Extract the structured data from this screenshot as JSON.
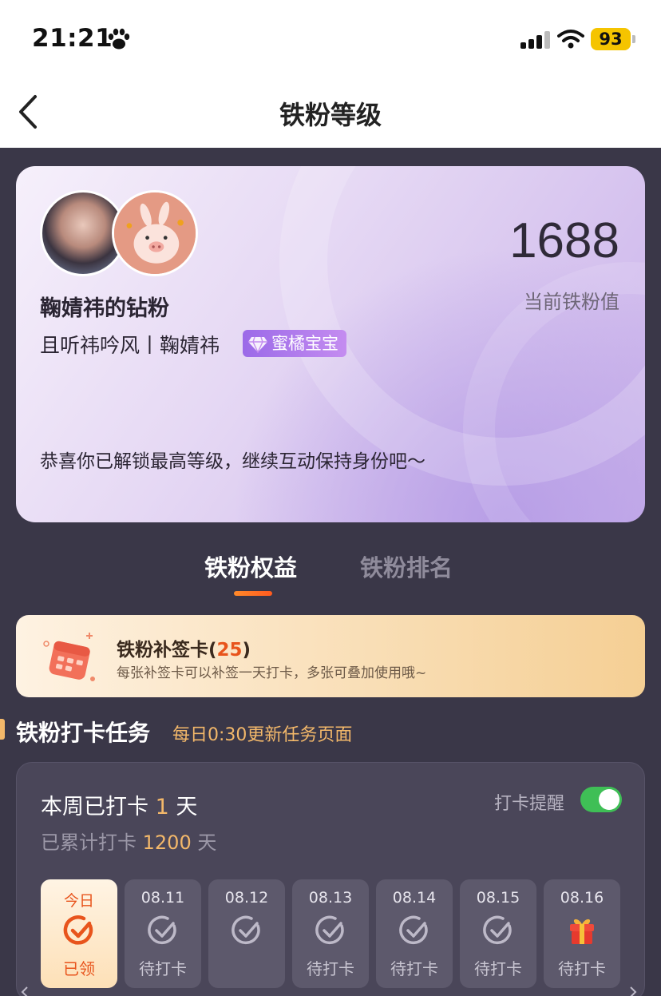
{
  "status_bar": {
    "time": "21:21",
    "battery": "93"
  },
  "nav": {
    "title": "铁粉等级"
  },
  "profile": {
    "score": "1688",
    "score_label": "当前铁粉值",
    "fan_name": "鞠婧祎的钻粉",
    "subtitle": "且听祎吟风丨鞠婧祎",
    "badge": "蜜橘宝宝",
    "message": "恭喜你已解锁最高等级，继续互动保持身份吧～"
  },
  "tabs": [
    {
      "label": "铁粉权益",
      "active": true
    },
    {
      "label": "铁粉排名",
      "active": false
    }
  ],
  "makeup_card": {
    "title": "铁粉补签卡(",
    "count": "25",
    "title_end": ")",
    "subtitle": "每张补签卡可以补签一天打卡，多张可叠加使用哦~"
  },
  "section": {
    "title": "铁粉打卡任务",
    "note": "每日0:30更新任务页面"
  },
  "checkin": {
    "week_prefix": "本周已打卡 ",
    "week_days": "1",
    "week_suffix": " 天",
    "total_prefix": "已累计打卡 ",
    "total_days": "1200",
    "total_suffix": " 天",
    "reminder_label": "打卡提醒",
    "reminder_on": true,
    "days": [
      {
        "date": "今日",
        "status": "已领",
        "icon": "check-circle-icon",
        "today": true
      },
      {
        "date": "08.11",
        "status": "待打卡",
        "icon": "check-circle-icon"
      },
      {
        "date": "08.12",
        "status": "",
        "icon": "check-circle-icon"
      },
      {
        "date": "08.13",
        "status": "待打卡",
        "icon": "check-circle-icon"
      },
      {
        "date": "08.14",
        "status": "待打卡",
        "icon": "check-circle-icon"
      },
      {
        "date": "08.15",
        "status": "待打卡",
        "icon": "check-circle-icon"
      },
      {
        "date": "08.16",
        "status": "待打卡",
        "icon": "gift-icon"
      }
    ]
  },
  "colors": {
    "accent": "#e8541c",
    "gold": "#f3b86a",
    "toggle_on": "#3fbf56",
    "page_bg": "#3a3748"
  }
}
